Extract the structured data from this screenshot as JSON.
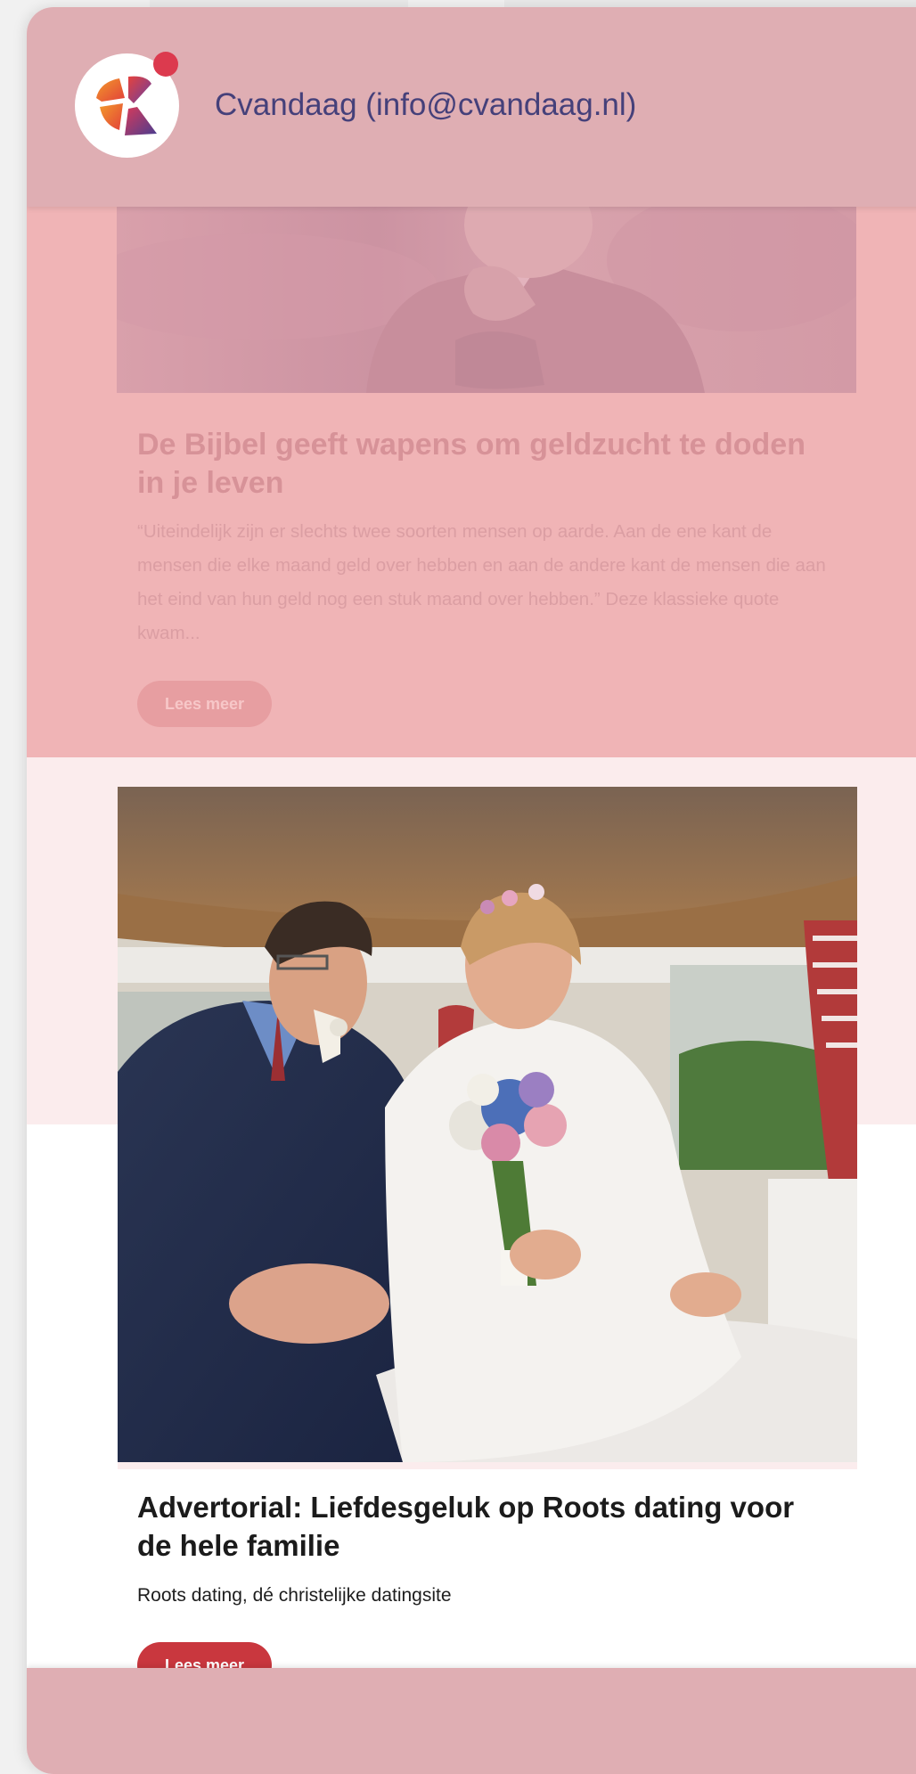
{
  "header": {
    "sender": "Cvandaag (info@cvandaag.nl)",
    "logo_icon": "cvandaag-logo-icon",
    "notification_dot_color": "#dc3a4e"
  },
  "articles": [
    {
      "title": "De Bijbel geeft wapens om geldzucht te doden in je leven",
      "excerpt": "“Uiteindelijk zijn er slechts twee soorten mensen op aarde. Aan de ene kant de mensen die elke maand geld over hebben en aan de andere kant de mensen die aan het eind van hun geld nog een stuk maand over hebben.” Deze klassieke quote kwam...",
      "button_label": "Lees meer"
    },
    {
      "title": "Advertorial: Liefdesgeluk op Roots dating voor de hele familie",
      "excerpt": "Roots dating, dé christelijke datingsite",
      "button_label": "Lees meer"
    }
  ],
  "colors": {
    "header_bg": "#dfaeb3",
    "brand_text": "#45407a",
    "button_red": "#c9373e",
    "faded_overlay": "#f0b4b6"
  }
}
